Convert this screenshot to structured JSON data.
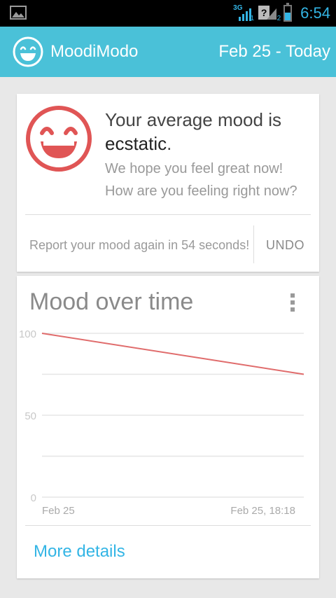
{
  "status_bar": {
    "network_type": "3G",
    "sim1_label": "1",
    "sim2_label": "2",
    "sim2_status": "?",
    "battery_level": 0.55,
    "time": "6:54",
    "accent_color": "#33b5e5"
  },
  "app_bar": {
    "title": "MoodiModo",
    "date_range": "Feb 25 - Today",
    "logo_icon": "smiley-face-icon",
    "background_color": "#4ac1d8"
  },
  "mood_card": {
    "line1": "Your average mood is",
    "mood_word": "ecstatic",
    "mood_punct": ".",
    "message1": "We hope you feel great now!",
    "message2": "How are you feeling right now?",
    "face_icon": "laughing-face-icon",
    "face_color": "#e05555",
    "report_text": "Report your mood again in 54 seconds!",
    "undo_label": "UNDO"
  },
  "chart_card": {
    "title": "Mood over time",
    "menu_icon": "overflow-menu-icon",
    "more_details_label": "More details"
  },
  "chart_data": {
    "type": "line",
    "x": [
      "Feb 25",
      "Feb 25, 18:18"
    ],
    "series": [
      {
        "values": [
          100,
          75
        ],
        "color": "#e06c6c"
      }
    ],
    "y_ticks": [
      "100",
      "50",
      "0"
    ],
    "ylim": [
      0,
      100
    ],
    "grid": true
  }
}
